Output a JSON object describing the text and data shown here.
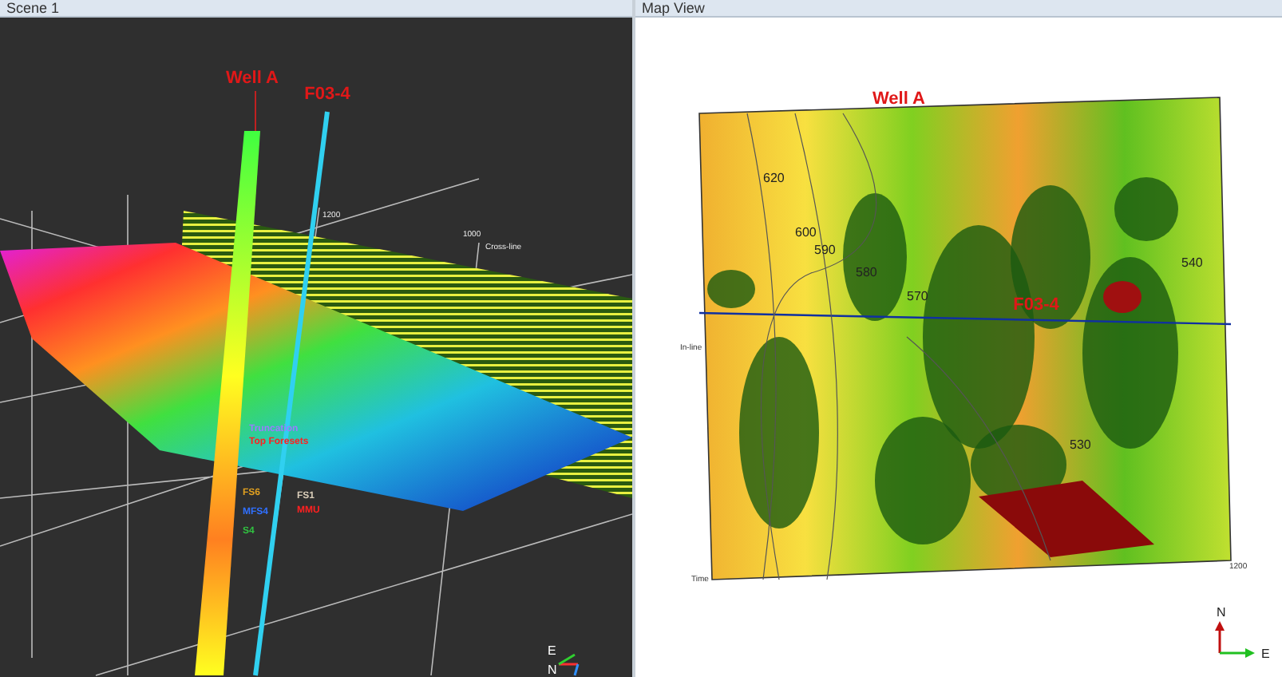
{
  "scene": {
    "title": "Scene 1",
    "wells": [
      {
        "name": "Well A"
      },
      {
        "name": "F03-4"
      }
    ],
    "markers": [
      {
        "label": "Truncation",
        "color": "#9a7cff"
      },
      {
        "label": "Top Foresets",
        "color": "#ff2020"
      },
      {
        "label": "FS6",
        "color": "#e0a020"
      },
      {
        "label": "MFS4",
        "color": "#3070ff"
      },
      {
        "label": "S4",
        "color": "#30c040"
      },
      {
        "label": "FS1",
        "color": "#d8ccb8"
      },
      {
        "label": "MMU",
        "color": "#ff2020"
      }
    ],
    "axis_labels": [
      "1200",
      "1000",
      "Cross-line"
    ],
    "compass": [
      "E",
      "N"
    ]
  },
  "map_view": {
    "title": "Map View",
    "wells": [
      {
        "name": "Well A"
      },
      {
        "name": "F03-4"
      }
    ],
    "contours": [
      "620",
      "600",
      "590",
      "580",
      "570",
      "540",
      "530"
    ],
    "axis_labels": [
      "In-line",
      "Time",
      "1200"
    ],
    "compass": [
      "N",
      "E"
    ]
  }
}
